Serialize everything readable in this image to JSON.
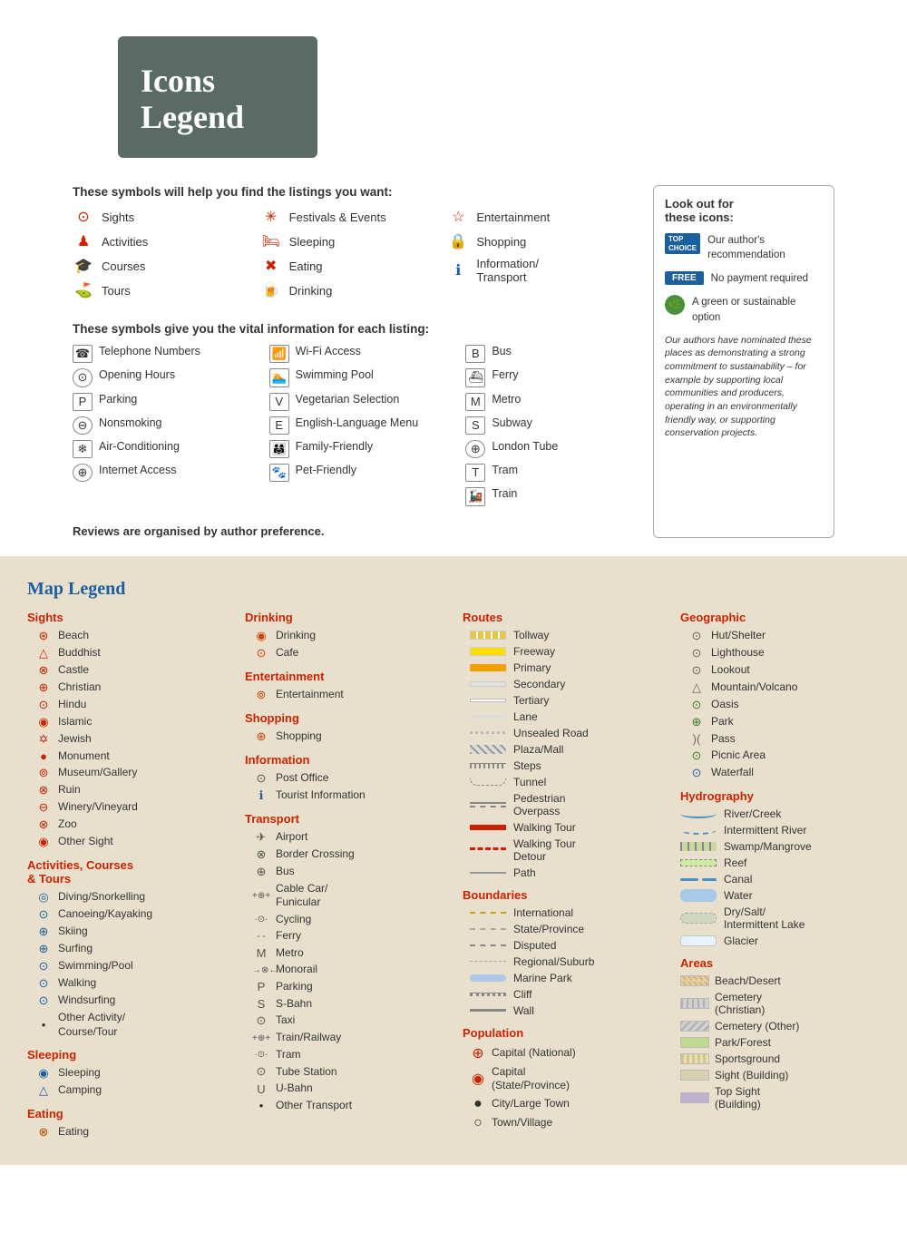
{
  "header": {
    "title_line1": "Icons",
    "title_line2": "Legend"
  },
  "symbols_section": {
    "title": "These symbols will help you find the listings you want:",
    "col1": [
      {
        "icon": "⊙",
        "label": "Sights",
        "color": "red"
      },
      {
        "icon": "🏃",
        "label": "Activities",
        "color": "red"
      },
      {
        "icon": "🎓",
        "label": "Courses",
        "color": "red"
      },
      {
        "icon": "🚩",
        "label": "Tours",
        "color": "red"
      }
    ],
    "col2": [
      {
        "icon": "✳",
        "label": "Festivals & Events",
        "color": "red"
      },
      {
        "icon": "🛏",
        "label": "Sleeping",
        "color": "red"
      },
      {
        "icon": "✖",
        "label": "Eating",
        "color": "red"
      },
      {
        "icon": "🍺",
        "label": "Drinking",
        "color": "red"
      }
    ],
    "col3": [
      {
        "icon": "☆",
        "label": "Entertainment",
        "color": "red"
      },
      {
        "icon": "🔒",
        "label": "Shopping",
        "color": "red"
      },
      {
        "icon": "ℹ",
        "label": "Information/Transport",
        "color": "blue"
      }
    ]
  },
  "vital_section": {
    "title": "These symbols give you the vital information for each listing:",
    "col1": [
      {
        "icon": "☎",
        "label": "Telephone Numbers"
      },
      {
        "icon": "⊙",
        "label": "Opening Hours"
      },
      {
        "icon": "P",
        "label": "Parking"
      },
      {
        "icon": "⊖",
        "label": "Nonsmoking"
      },
      {
        "icon": "❄",
        "label": "Air-Conditioning"
      },
      {
        "icon": "⊕",
        "label": "Internet Access"
      }
    ],
    "col2": [
      {
        "icon": "wifi",
        "label": "Wi-Fi Access"
      },
      {
        "icon": "🏊",
        "label": "Swimming Pool"
      },
      {
        "icon": "V",
        "label": "Vegetarian Selection"
      },
      {
        "icon": "E",
        "label": "English-Language Menu"
      },
      {
        "icon": "👨‍👩‍👧",
        "label": "Family-Friendly"
      },
      {
        "icon": "🐾",
        "label": "Pet-Friendly"
      }
    ],
    "col3": [
      {
        "icon": "B",
        "label": "Bus"
      },
      {
        "icon": "⛴",
        "label": "Ferry"
      },
      {
        "icon": "M",
        "label": "Metro"
      },
      {
        "icon": "S",
        "label": "Subway"
      },
      {
        "icon": "⊕",
        "label": "London Tube"
      },
      {
        "icon": "T",
        "label": "Tram"
      },
      {
        "icon": "🚂",
        "label": "Train"
      }
    ]
  },
  "reviews_note": "Reviews are organised by author preference.",
  "look_box": {
    "title": "Look out for these icons:",
    "items": [
      {
        "badge": "TOP CHOICE",
        "text": "Our author's recommendation"
      },
      {
        "badge": "FREE",
        "text": "No payment required"
      },
      {
        "badge": "leaf",
        "text": "A green or sustainable option"
      }
    ],
    "note": "Our authors have nominated these places as demonstrating a strong commitment to sustainability – for example by supporting local communities and producers, operating in an environmentally friendly way, or supporting conservation projects."
  },
  "map_legend": {
    "title": "Map Legend",
    "sights": {
      "title": "Sights",
      "items": [
        {
          "icon": "⊛",
          "label": "Beach",
          "color": "red"
        },
        {
          "icon": "△",
          "label": "Buddhist",
          "color": "red"
        },
        {
          "icon": "⊗",
          "label": "Castle",
          "color": "red"
        },
        {
          "icon": "⊕",
          "label": "Christian",
          "color": "red"
        },
        {
          "icon": "⊙",
          "label": "Hindu",
          "color": "red"
        },
        {
          "icon": "◉",
          "label": "Islamic",
          "color": "red"
        },
        {
          "icon": "⊙",
          "label": "Jewish",
          "color": "red"
        },
        {
          "icon": "●",
          "label": "Monument",
          "color": "red"
        },
        {
          "icon": "⊚",
          "label": "Museum/Gallery",
          "color": "red"
        },
        {
          "icon": "⊗",
          "label": "Ruin",
          "color": "red"
        },
        {
          "icon": "⊖",
          "label": "Winery/Vineyard",
          "color": "red"
        },
        {
          "icon": "⊗",
          "label": "Zoo",
          "color": "red"
        },
        {
          "icon": "◉",
          "label": "Other Sight",
          "color": "red"
        }
      ]
    },
    "activities": {
      "title": "Activities, Courses & Tours",
      "items": [
        {
          "icon": "◎",
          "label": "Diving/Snorkelling"
        },
        {
          "icon": "⊙",
          "label": "Canoeing/Kayaking"
        },
        {
          "icon": "⊕",
          "label": "Skiing"
        },
        {
          "icon": "⊕",
          "label": "Surfing"
        },
        {
          "icon": "⊙",
          "label": "Swimming/Pool"
        },
        {
          "icon": "⊙",
          "label": "Walking"
        },
        {
          "icon": "⊙",
          "label": "Windsurfing"
        },
        {
          "icon": "•",
          "label": "Other Activity/Course/Tour"
        }
      ]
    },
    "sleeping": {
      "title": "Sleeping",
      "items": [
        {
          "icon": "◉",
          "label": "Sleeping"
        },
        {
          "icon": "△",
          "label": "Camping"
        }
      ]
    },
    "eating": {
      "title": "Eating",
      "items": [
        {
          "icon": "⊗",
          "label": "Eating"
        }
      ]
    },
    "drinking": {
      "title": "Drinking",
      "items": [
        {
          "icon": "◉",
          "label": "Drinking"
        },
        {
          "icon": "⊙",
          "label": "Cafe"
        }
      ]
    },
    "entertainment": {
      "title": "Entertainment",
      "items": [
        {
          "icon": "⊚",
          "label": "Entertainment"
        }
      ]
    },
    "shopping": {
      "title": "Shopping",
      "items": [
        {
          "icon": "⊕",
          "label": "Shopping"
        }
      ]
    },
    "information": {
      "title": "Information",
      "items": [
        {
          "icon": "⊙",
          "label": "Post Office"
        },
        {
          "icon": "ℹ",
          "label": "Tourist Information"
        }
      ]
    },
    "transport": {
      "title": "Transport",
      "items": [
        {
          "icon": "✈",
          "label": "Airport"
        },
        {
          "icon": "⊗",
          "label": "Border Crossing"
        },
        {
          "icon": "⊕",
          "label": "Bus"
        },
        {
          "icon": "++⊕++",
          "label": "Cable Car/Funicular"
        },
        {
          "icon": "·⊙·",
          "label": "Cycling"
        },
        {
          "icon": "- -",
          "label": "Ferry"
        },
        {
          "icon": "M",
          "label": "Metro"
        },
        {
          "icon": "→⊗←",
          "label": "Monorail"
        },
        {
          "icon": "P",
          "label": "Parking"
        },
        {
          "icon": "S",
          "label": "S-Bahn"
        },
        {
          "icon": "⊙",
          "label": "Taxi"
        },
        {
          "icon": "++⊕++",
          "label": "Train/Railway"
        },
        {
          "icon": "·⊙·",
          "label": "Tram"
        },
        {
          "icon": "⊙",
          "label": "Tube Station"
        },
        {
          "icon": "U",
          "label": "U-Bahn"
        },
        {
          "icon": "•",
          "label": "Other Transport"
        }
      ]
    },
    "routes": {
      "title": "Routes",
      "items": [
        {
          "type": "tollway",
          "label": "Tollway"
        },
        {
          "type": "freeway",
          "label": "Freeway"
        },
        {
          "type": "primary",
          "label": "Primary"
        },
        {
          "type": "secondary",
          "label": "Secondary"
        },
        {
          "type": "tertiary",
          "label": "Tertiary"
        },
        {
          "type": "lane",
          "label": "Lane"
        },
        {
          "type": "unsealed",
          "label": "Unsealed Road"
        },
        {
          "type": "plaza",
          "label": "Plaza/Mall"
        },
        {
          "type": "steps",
          "label": "Steps"
        },
        {
          "type": "tunnel",
          "label": "Tunnel"
        },
        {
          "type": "pedestrian",
          "label": "Pedestrian Overpass"
        },
        {
          "type": "walking-tour",
          "label": "Walking Tour"
        },
        {
          "type": "walking-detour",
          "label": "Walking Tour Detour"
        },
        {
          "type": "path",
          "label": "Path"
        }
      ]
    },
    "boundaries": {
      "title": "Boundaries",
      "items": [
        {
          "type": "international",
          "label": "International"
        },
        {
          "type": "state",
          "label": "State/Province"
        },
        {
          "type": "disputed",
          "label": "Disputed"
        },
        {
          "type": "regional",
          "label": "Regional/Suburb"
        },
        {
          "type": "marine",
          "label": "Marine Park"
        },
        {
          "type": "cliff",
          "label": "Cliff"
        },
        {
          "type": "wall",
          "label": "Wall"
        }
      ]
    },
    "population": {
      "title": "Population",
      "items": [
        {
          "icon": "⊕",
          "label": "Capital (National)"
        },
        {
          "icon": "◉",
          "label": "Capital (State/Province)"
        },
        {
          "icon": "●",
          "label": "City/Large Town"
        },
        {
          "icon": "○",
          "label": "Town/Village"
        }
      ]
    },
    "geographic": {
      "title": "Geographic",
      "items": [
        {
          "icon": "⊙",
          "label": "Hut/Shelter"
        },
        {
          "icon": "⊙",
          "label": "Lighthouse"
        },
        {
          "icon": "⊙",
          "label": "Lookout"
        },
        {
          "icon": "△",
          "label": "Mountain/Volcano"
        },
        {
          "icon": "⊙",
          "label": "Oasis"
        },
        {
          "icon": "⊕",
          "label": "Park"
        },
        {
          "icon": ")(",
          "label": "Pass"
        },
        {
          "icon": "⊙",
          "label": "Picnic Area"
        },
        {
          "icon": "⊙",
          "label": "Waterfall"
        }
      ]
    },
    "hydrography": {
      "title": "Hydrography",
      "items": [
        {
          "type": "river",
          "label": "River/Creek"
        },
        {
          "type": "intermittent-river",
          "label": "Intermittent River"
        },
        {
          "type": "swamp",
          "label": "Swamp/Mangrove"
        },
        {
          "type": "reef",
          "label": "Reef"
        },
        {
          "type": "canal",
          "label": "Canal"
        },
        {
          "type": "water",
          "label": "Water"
        },
        {
          "type": "dry-lake",
          "label": "Dry/Salt/Intermittent Lake"
        },
        {
          "type": "glacier",
          "label": "Glacier"
        }
      ]
    },
    "areas": {
      "title": "Areas",
      "items": [
        {
          "color": "#d4b483",
          "pattern": "dots",
          "label": "Beach/Desert"
        },
        {
          "color": "#c8c8c8",
          "pattern": "lines",
          "label": "Cemetery (Christian)"
        },
        {
          "color": "#b8b8b8",
          "pattern": "cross",
          "label": "Cemetery (Other)"
        },
        {
          "color": "#c8ddb0",
          "pattern": "solid",
          "label": "Park/Forest"
        },
        {
          "color": "#d0c8a8",
          "pattern": "dots2",
          "label": "Sportsground"
        },
        {
          "color": "#e0d8b8",
          "pattern": "solid2",
          "label": "Sight (Building)"
        },
        {
          "color": "#c8b8d8",
          "pattern": "solid3",
          "label": "Top Sight (Building)"
        }
      ]
    }
  }
}
